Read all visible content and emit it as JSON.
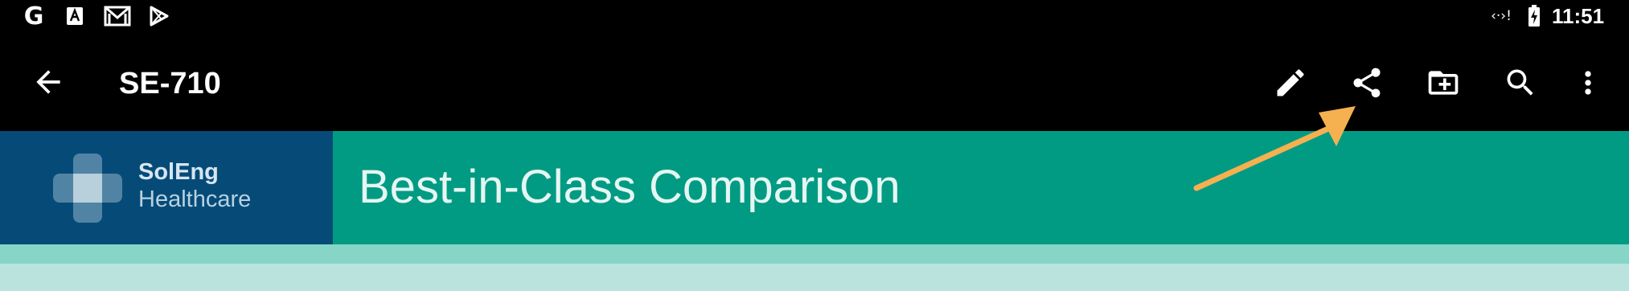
{
  "status_bar": {
    "time": "11:51",
    "left_icons": [
      "google-icon",
      "a-notification-icon",
      "gmail-icon",
      "play-store-icon"
    ],
    "right_icons": [
      "signal-icon",
      "battery-charging-icon"
    ],
    "google_glyph": "G",
    "signal_glyph": "‹·›!"
  },
  "app_bar": {
    "title": "SE-710",
    "actions": [
      "edit-icon",
      "share-icon",
      "add-to-folder-icon",
      "search-icon",
      "more-options-icon"
    ]
  },
  "slide": {
    "brand_name": "SolEng",
    "brand_sub": "Healthcare",
    "title": "Best-in-Class  Comparison",
    "colors": {
      "brand_panel": "#064b78",
      "title_panel": "#019b84",
      "band_mid": "#86d5c7",
      "band_low": "#bae3de"
    }
  },
  "annotation": {
    "type": "arrow",
    "color": "#f5b04f",
    "points_to": "share-icon"
  }
}
